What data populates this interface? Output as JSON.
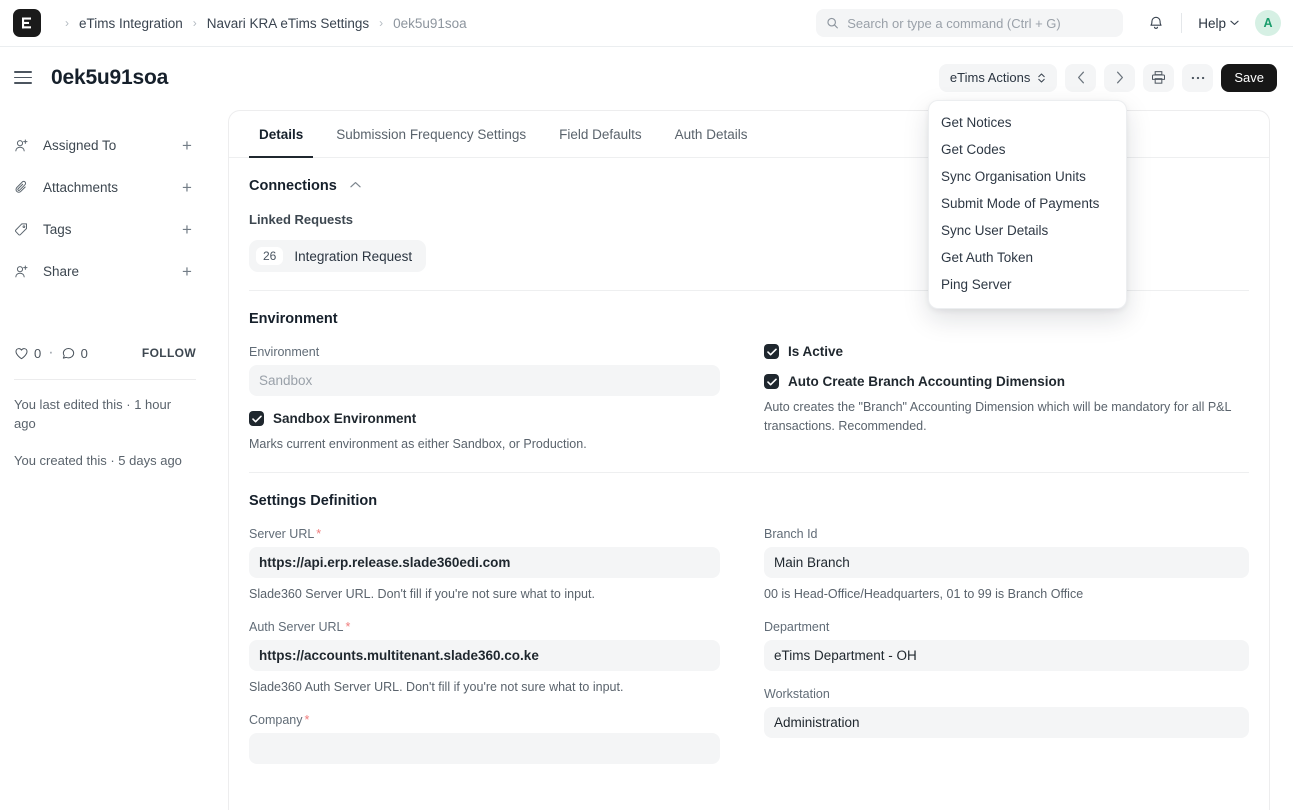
{
  "navbar": {
    "logo_letter": "E",
    "breadcrumb": [
      {
        "label": "eTims Integration",
        "muted": false
      },
      {
        "label": "Navari KRA eTims Settings",
        "muted": false
      },
      {
        "label": "0ek5u91soa",
        "muted": true
      }
    ],
    "separator": "›",
    "search": {
      "placeholder": "Search or type a command (Ctrl + G)",
      "value": "",
      "icon": "search-icon"
    },
    "bell_icon": "bell-icon",
    "help_label": "Help",
    "help_caret": "chevron-down-icon",
    "avatar_letter": "A"
  },
  "page_header": {
    "title": "0ek5u91soa",
    "menu_icon": "hamburger-icon",
    "actions": {
      "etims_actions_label": "eTims Actions",
      "prev_label": "‹",
      "next_label": "›",
      "print_icon": "printer-icon",
      "more_label": "⋯",
      "save_label": "Save"
    }
  },
  "dropdown": {
    "items": [
      "Get Notices",
      "Get Codes",
      "Sync Organisation Units",
      "Submit Mode of Payments",
      "Sync User Details",
      "Get Auth Token",
      "Ping Server"
    ]
  },
  "sidebar": {
    "items": [
      {
        "label": "Assigned To",
        "icon": "user-plus-icon",
        "action": "+"
      },
      {
        "label": "Attachments",
        "icon": "paperclip-icon",
        "action": "+"
      },
      {
        "label": "Tags",
        "icon": "tag-icon",
        "action": "+"
      },
      {
        "label": "Share",
        "icon": "share-user-icon",
        "action": "+"
      }
    ],
    "likes_count": "0",
    "comments_count": "0",
    "dot": "·",
    "follow_label": "FOLLOW",
    "last_edited": "You last edited this · 1 hour ago",
    "created": "You created this · 5 days ago"
  },
  "tabs": [
    {
      "label": "Details",
      "active": true
    },
    {
      "label": "Submission Frequency Settings",
      "active": false
    },
    {
      "label": "Field Defaults",
      "active": false
    },
    {
      "label": "Auth Details",
      "active": false
    }
  ],
  "connections": {
    "title": "Connections",
    "collapse_icon": "chevron-up-icon",
    "linked_requests_label": "Linked Requests",
    "pill": {
      "count": "26",
      "label": "Integration Request"
    }
  },
  "environment": {
    "title": "Environment",
    "fields": [
      {
        "label": "Environment",
        "value": "",
        "placeholder": "Sandbox",
        "required": false,
        "help": ""
      }
    ],
    "sandbox_checkbox": {
      "label": "Sandbox Environment",
      "checked": true,
      "help": "Marks current environment as either Sandbox, or Production."
    },
    "is_active_checkbox": {
      "label": "Is Active",
      "checked": true
    },
    "auto_branch_checkbox": {
      "label": "Auto Create Branch Accounting Dimension",
      "checked": true,
      "help": "Auto creates the \"Branch\" Accounting Dimension which will be mandatory for all P&L transactions. Recommended."
    }
  },
  "settings_definition": {
    "title": "Settings Definition",
    "left_fields": [
      {
        "label": "Server URL",
        "required": true,
        "value": "https://api.erp.release.slade360edi.com",
        "help": "Slade360 Server URL. Don't fill if you're not sure what to input."
      },
      {
        "label": "Auth Server URL",
        "required": true,
        "value": "https://accounts.multitenant.slade360.co.ke",
        "help": "Slade360 Auth Server URL. Don't fill if you're not sure what to input."
      },
      {
        "label": "Company",
        "required": true,
        "value": "",
        "help": ""
      }
    ],
    "right_fields": [
      {
        "label": "Branch Id",
        "required": false,
        "value": "Main Branch",
        "help": "00 is Head-Office/Headquarters, 01 to 99 is Branch Office"
      },
      {
        "label": "Department",
        "required": false,
        "value": "eTims Department - OH",
        "help": ""
      },
      {
        "label": "Workstation",
        "required": false,
        "value": "Administration",
        "help": ""
      }
    ]
  },
  "colors": {
    "accent_dark": "#171717",
    "field_bg": "#f4f5f6",
    "required_red": "#ef7b7b",
    "avatar_bg": "#d6f0e4",
    "avatar_fg": "#1a9d6c"
  }
}
